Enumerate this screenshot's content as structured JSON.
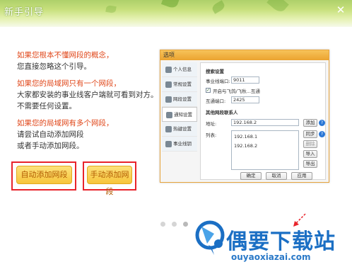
{
  "window": {
    "title": "新手引导",
    "close_glyph": "✕"
  },
  "guide": {
    "p1": [
      "如果您根本不懂网段的概念，",
      "您直接忽略这个引导。"
    ],
    "p2": [
      "如果您的局域网只有一个网段，",
      "大家都安装的事业线客户端就可看到对方。",
      "不需要任何设置。"
    ],
    "p3": [
      "如果您的局域网有多个网段，",
      "请尝试自动添加网段",
      "或者手动添加网段。"
    ],
    "auto_button": "自动添加网段",
    "manual_button": "手动添加网段"
  },
  "dialog": {
    "title": "选项",
    "sidebar": [
      "个人信息",
      "常规设置",
      "网段设置",
      "通知设置",
      "热键设置",
      "事业线钥"
    ],
    "active_index": 2,
    "section_search": "搜索设置",
    "port_label": "事业线端口:",
    "port_value": "9011",
    "checkbox_label": "开启与飞鸽/飞秋...互通",
    "interop_port_label": "互通端口:",
    "interop_port_value": "2425",
    "section_other": "其他网段联系人",
    "address_label": "地址:",
    "address_value": "192.168.2",
    "list_label": "列表:",
    "list_items": [
      "192.168.1",
      "192.168.2"
    ],
    "btn_add": "添加",
    "btn_sync": "同步",
    "btn_delete": "删除",
    "btn_import": "导入",
    "btn_export": "导出",
    "btn_ok": "确定",
    "btn_cancel": "取消",
    "btn_apply": "应用",
    "help_glyph": "?"
  },
  "watermark": {
    "name": "偶要下载站",
    "url": "ouyaoxiazai.com"
  },
  "colors": {
    "accent_red": "#e0471a",
    "highlight_box": "#e8232b",
    "button_gold": "#f7c43b",
    "watermark_blue": "#1b6fc4"
  }
}
